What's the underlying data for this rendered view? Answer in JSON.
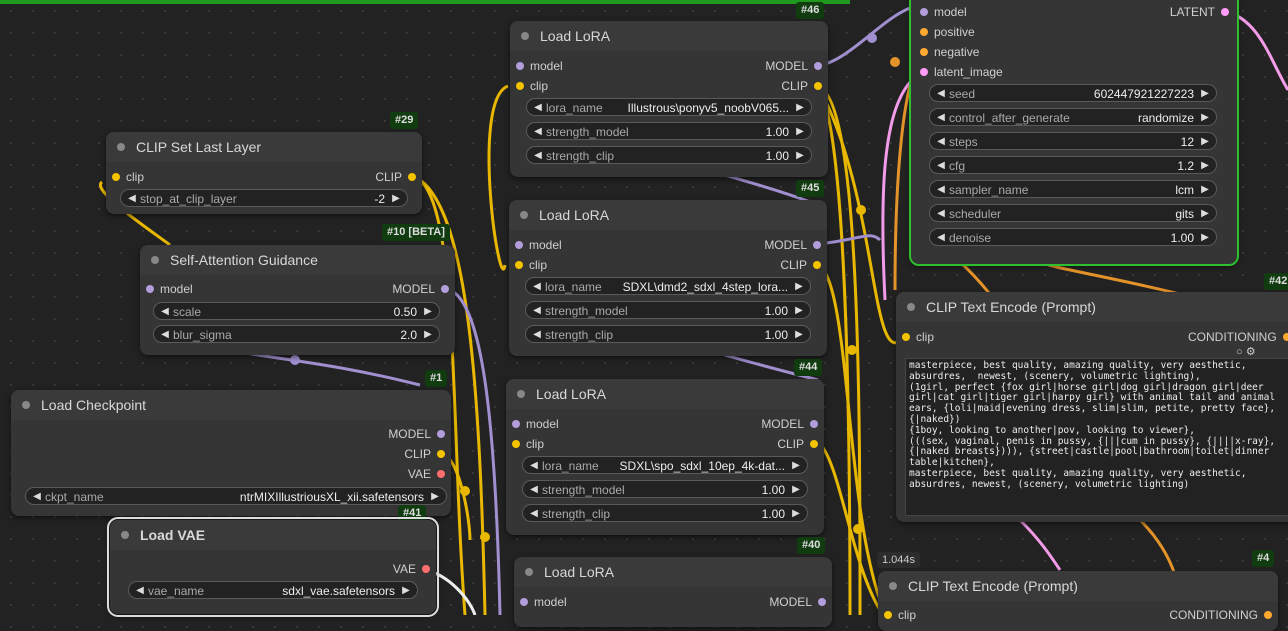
{
  "nodes": {
    "n46": {
      "id": "#46",
      "title": "Load LoRA",
      "in_model": "model",
      "in_clip": "clip",
      "out_model": "MODEL",
      "out_clip": "CLIP",
      "w1_label": "lora_name",
      "w1_value": "Illustrous\\ponyv5_noobV065...",
      "w2_label": "strength_model",
      "w2_value": "1.00",
      "w3_label": "strength_clip",
      "w3_value": "1.00"
    },
    "n45": {
      "id": "#45",
      "title": "Load LoRA",
      "in_model": "model",
      "in_clip": "clip",
      "out_model": "MODEL",
      "out_clip": "CLIP",
      "w1_label": "lora_name",
      "w1_value": "SDXL\\dmd2_sdxl_4step_lora...",
      "w2_label": "strength_model",
      "w2_value": "1.00",
      "w3_label": "strength_clip",
      "w3_value": "1.00"
    },
    "n44": {
      "id": "#44",
      "title": "Load LoRA",
      "in_model": "model",
      "in_clip": "clip",
      "out_model": "MODEL",
      "out_clip": "CLIP",
      "w1_label": "lora_name",
      "w1_value": "SDXL\\spo_sdxl_10ep_4k-dat...",
      "w2_label": "strength_model",
      "w2_value": "1.00",
      "w3_label": "strength_clip",
      "w3_value": "1.00"
    },
    "n40": {
      "id": "#40",
      "title": "Load LoRA",
      "in_model": "model",
      "out_model": "MODEL"
    },
    "n29": {
      "id": "#29",
      "title": "CLIP Set Last Layer",
      "in_clip": "clip",
      "out_clip": "CLIP",
      "w1_label": "stop_at_clip_layer",
      "w1_value": "-2"
    },
    "n10": {
      "id": "#10 [BETA]",
      "title": "Self-Attention Guidance",
      "in_model": "model",
      "out_model": "MODEL",
      "w1_label": "scale",
      "w1_value": "0.50",
      "w2_label": "blur_sigma",
      "w2_value": "2.0"
    },
    "n1": {
      "id": "#1",
      "title": "Load Checkpoint",
      "out_model": "MODEL",
      "out_clip": "CLIP",
      "out_vae": "VAE",
      "w1_label": "ckpt_name",
      "w1_value": "ntrMIXIllustriousXL_xii.safetensors"
    },
    "n41": {
      "id": "#41",
      "title": "Load VAE",
      "out_vae": "VAE",
      "w1_label": "vae_name",
      "w1_value": "sdxl_vae.safetensors"
    },
    "ksampler": {
      "in_model": "model",
      "in_positive": "positive",
      "in_negative": "negative",
      "in_latent": "latent_image",
      "out_latent": "LATENT",
      "seed_label": "seed",
      "seed_value": "602447921227223",
      "cag_label": "control_after_generate",
      "cag_value": "randomize",
      "steps_label": "steps",
      "steps_value": "12",
      "cfg_label": "cfg",
      "cfg_value": "1.2",
      "sampler_label": "sampler_name",
      "sampler_value": "lcm",
      "scheduler_label": "scheduler",
      "scheduler_value": "gits",
      "denoise_label": "denoise",
      "denoise_value": "1.00"
    },
    "n42": {
      "id": "#42",
      "title": "CLIP Text Encode (Prompt)",
      "in_clip": "clip",
      "out_cond": "CONDITIONING",
      "text": "masterpiece, best quality, amazing quality, very aesthetic, absurdres,  newest, (scenery, volumetric lighting),\n(1girl, perfect {fox girl|horse girl|dog girl|dragon girl|deer girl|cat girl|tiger girl|harpy girl} with animal tail and animal ears, {loli|maid|evening dress, slim|slim, petite, pretty face}, {|naked})\n{1boy, looking to another|pov, looking to viewer},\n(((sex, vaginal, penis in pussy, {|||cum in pussy}, {||||x-ray}, {|naked breasts}))), {street|castle|pool|bathroom|toilet|dinner table|kitchen},\nmasterpiece, best quality, amazing quality, very aesthetic, absurdres, newest, (scenery, volumetric lighting)"
    },
    "n4": {
      "id": "#4",
      "title": "CLIP Text Encode (Prompt)",
      "timing": "1.044s",
      "in_clip": "clip",
      "out_cond": "CONDITIONING"
    }
  }
}
